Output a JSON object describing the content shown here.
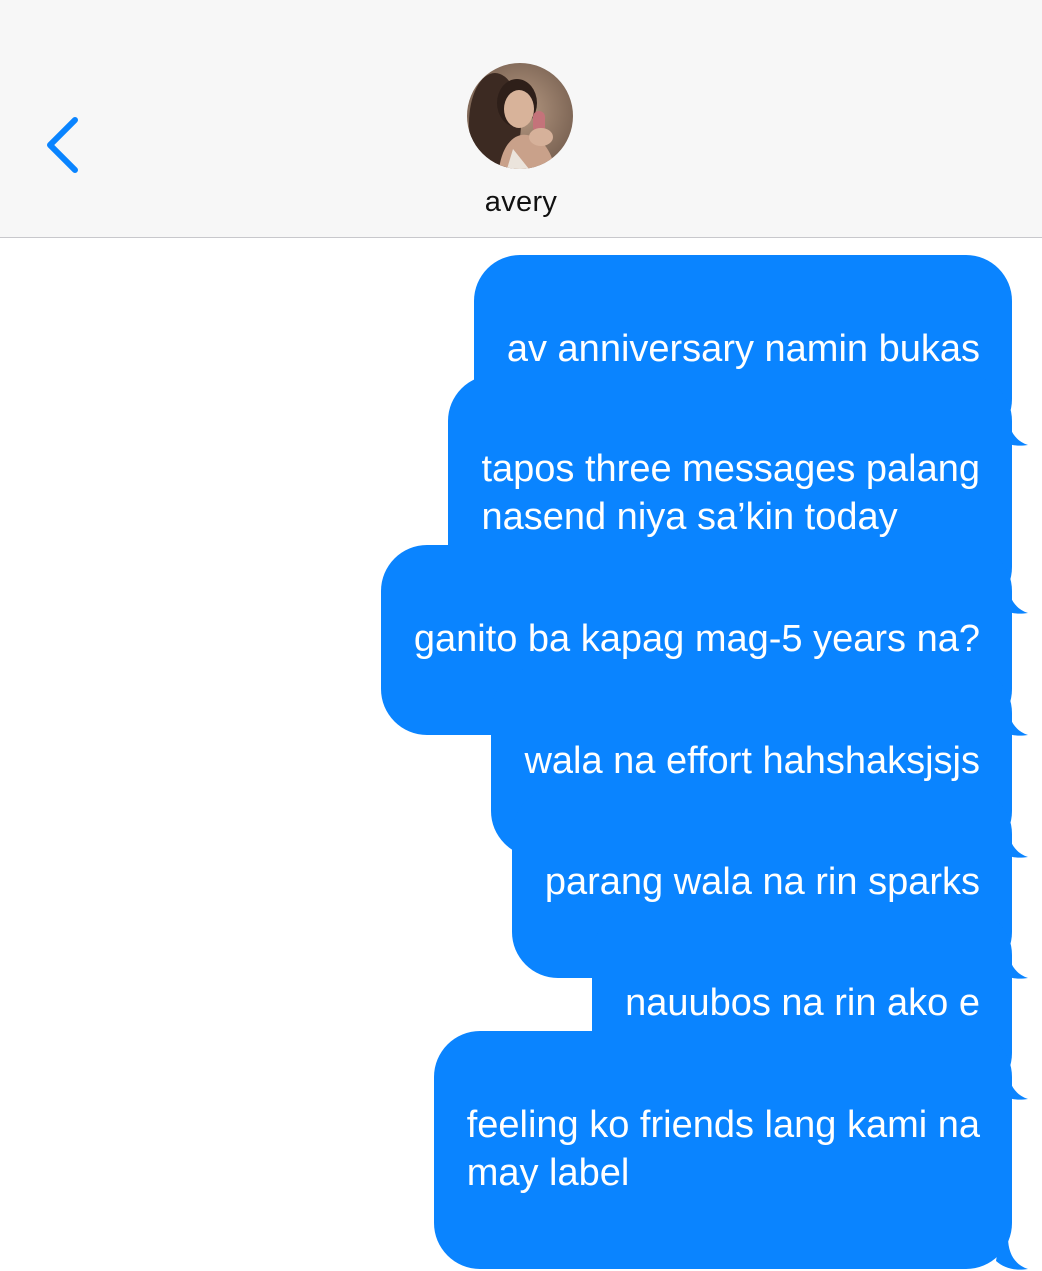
{
  "header": {
    "back_icon": "chevron-left-icon",
    "contact_name": "avery",
    "accent_color": "#0a84ff"
  },
  "messages": [
    {
      "text": "av anniversary namin bukas",
      "direction": "outgoing"
    },
    {
      "text": "tapos three messages palang\nnasend niya sa’kin today",
      "direction": "outgoing"
    },
    {
      "text": "ganito ba kapag mag-5 years na?",
      "direction": "outgoing"
    },
    {
      "text": "wala na effort hahshaksjsjs",
      "direction": "outgoing"
    },
    {
      "text": "parang wala na rin sparks",
      "direction": "outgoing"
    },
    {
      "text": "nauubos na rin ako e",
      "direction": "outgoing"
    },
    {
      "text": "feeling ko friends lang kami na\nmay label",
      "direction": "outgoing"
    }
  ]
}
